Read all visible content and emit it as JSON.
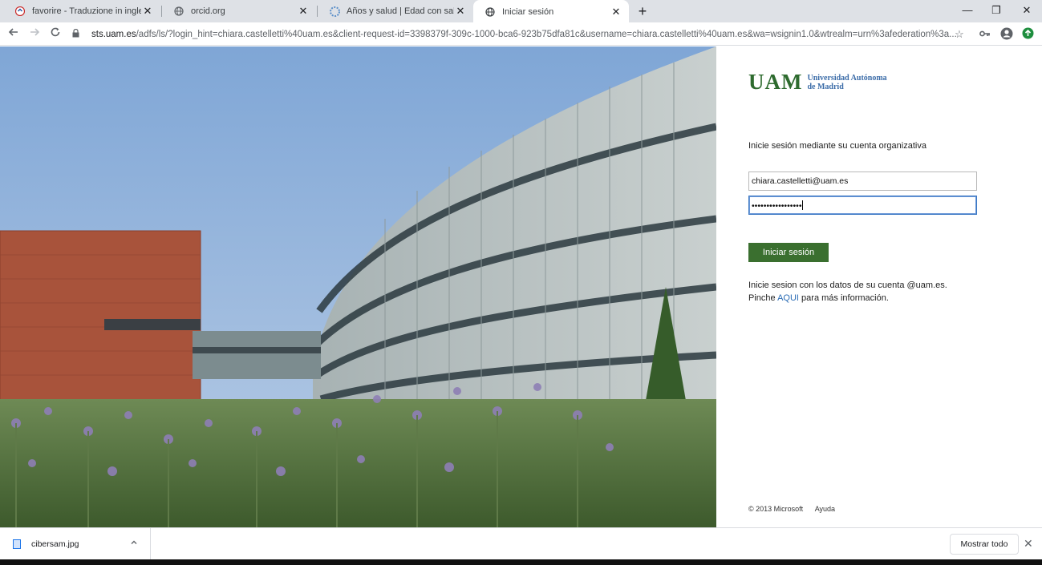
{
  "tabs": [
    {
      "title": "favorire - Traduzione in inglese -",
      "close": "✕"
    },
    {
      "title": "orcid.org",
      "close": "✕"
    },
    {
      "title": "Años y salud | Edad con salud",
      "close": "✕"
    },
    {
      "title": "Iniciar sesión",
      "close": "✕"
    }
  ],
  "new_tab": "+",
  "window_controls": {
    "minimize": "—",
    "restore": "❐",
    "close": "✕"
  },
  "address_bar": {
    "host": "sts.uam.es",
    "path": "/adfs/ls/?login_hint=chiara.castelletti%40uam.es&client-request-id=3398379f-309c-1000-bca6-923b75dfa81c&username=chiara.castelletti%40uam.es&wa=wsignin1.0&wtrealm=urn%3afederation%3a..."
  },
  "page": {
    "logo_text": "UAM",
    "logo_name_line1": "Universidad Autónoma",
    "logo_name_line2": "de Madrid",
    "heading": "Inicie sesión mediante su cuenta organizativa",
    "username_value": "chiara.castelletti@uam.es",
    "password_value": "•••••••••••••••••",
    "signin_label": "Iniciar sesión",
    "info_line1": "Inicie sesion con los datos de su cuenta @uam.es.",
    "info_line2_before": "Pinche ",
    "info_link": "AQUI",
    "info_line2_after": " para más información.",
    "copyright": "© 2013 Microsoft",
    "help": "Ayuda"
  },
  "downloads": {
    "file_name": "cibersam.jpg",
    "show_all": "Mostrar todo"
  },
  "colors": {
    "brand_green": "#3a6f2f",
    "link_blue": "#2b6cb5"
  }
}
